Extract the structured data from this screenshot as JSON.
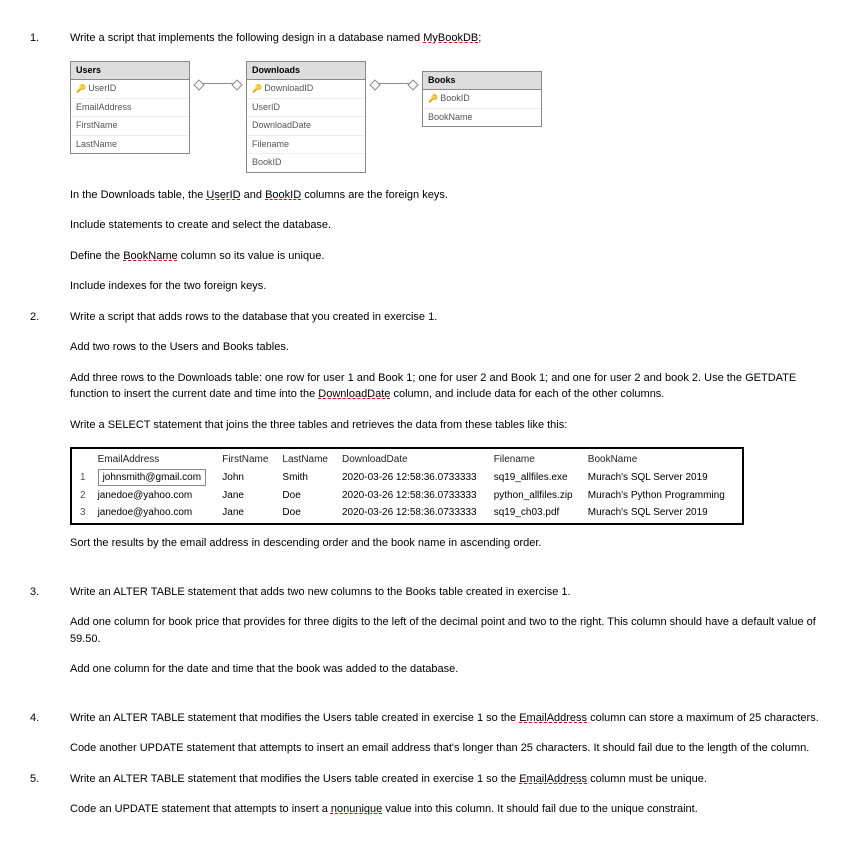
{
  "q1": {
    "num": "1.",
    "intro_a": "Write a script that implements the following design in a database named ",
    "intro_b": "MyBookDB",
    "intro_c": ";",
    "er": {
      "users": {
        "title": "Users",
        "cols": [
          "UserID",
          "EmailAddress",
          "FirstName",
          "LastName"
        ]
      },
      "downloads": {
        "title": "Downloads",
        "cols": [
          "DownloadID",
          "UserID",
          "DownloadDate",
          "Filename",
          "BookID"
        ]
      },
      "books": {
        "title": "Books",
        "cols": [
          "BookID",
          "BookName"
        ]
      }
    },
    "p2_a": "In the Downloads table, the ",
    "p2_b": "UserID",
    "p2_c": " and ",
    "p2_d": "BookID",
    "p2_e": " columns are the foreign keys.",
    "p3": "Include statements to create and select the database.",
    "p4_a": "Define the ",
    "p4_b": "BookName",
    "p4_c": " column so its value is unique.",
    "p5": "Include indexes for the two foreign keys."
  },
  "q2": {
    "num": "2.",
    "p1": "Write a script that adds rows to the database that you created in exercise 1.",
    "p2": "Add two rows to the Users and Books tables.",
    "p3_a": "Add three rows to the Downloads table: one row for user 1 and Book 1; one for user 2 and Book 1; and one for user 2 and book 2. Use the GETDATE function to insert the current date and time into the ",
    "p3_b": "DownloadDate",
    "p3_c": " column, and include data for each of the other columns.",
    "p4": "Write a SELECT statement that joins the three tables and retrieves the data from these tables like this:",
    "table": {
      "headers": [
        "",
        "EmailAddress",
        "FirstName",
        "LastName",
        "DownloadDate",
        "Filename",
        "BookName"
      ],
      "rows": [
        [
          "1",
          "johnsmith@gmail.com",
          "John",
          "Smith",
          "2020-03-26 12:58:36.0733333",
          "sq19_allfiles.exe",
          "Murach's SQL Server 2019"
        ],
        [
          "2",
          "janedoe@yahoo.com",
          "Jane",
          "Doe",
          "2020-03-26 12:58:36.0733333",
          "python_allfiles.zip",
          "Murach's Python Programming"
        ],
        [
          "3",
          "janedoe@yahoo.com",
          "Jane",
          "Doe",
          "2020-03-26 12:58:36.0733333",
          "sq19_ch03.pdf",
          "Murach's SQL Server 2019"
        ]
      ]
    },
    "p5": "Sort the results by the email address in descending order and the book name in ascending order."
  },
  "q3": {
    "num": "3.",
    "p1": "Write an ALTER TABLE statement that adds two new columns to the Books table created in exercise 1.",
    "p2": "Add one column for book price that provides for three digits to the left of the decimal point and two to the right. This column should have a default value of 59.50.",
    "p3": "Add one column for the date and time that the book was added to the database."
  },
  "q4": {
    "num": "4.",
    "p1_a": "Write an ALTER TABLE statement that modifies the Users table created in exercise 1 so the ",
    "p1_b": "EmailAddress",
    "p1_c": " column can store a maximum of 25 characters.",
    "p2": "Code another UPDATE statement that attempts to insert an email address that's longer than 25 characters. It should fail due to the length of the column."
  },
  "q5": {
    "num": "5.",
    "p1_a": "Write an ALTER TABLE statement that modifies the Users table created in exercise 1 so the ",
    "p1_b": "EmailAddress",
    "p1_c": " column must be unique.",
    "p2_a": "Code an UPDATE statement that attempts to insert a ",
    "p2_b": "nonunique",
    "p2_c": " value into this column. It should fail due to the unique constraint."
  }
}
